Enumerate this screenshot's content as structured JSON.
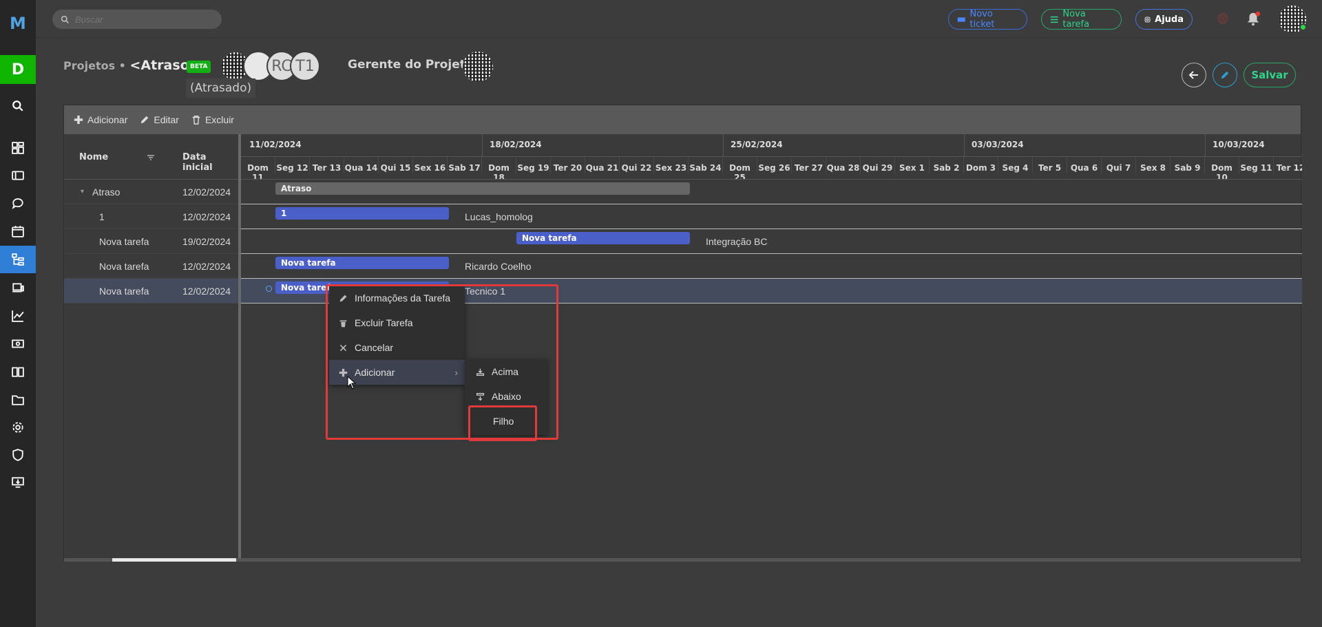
{
  "sidebar": {
    "logo": "M",
    "workspace_initial": "D",
    "items": [
      {
        "name": "search-icon"
      },
      {
        "name": "dashboard-icon"
      },
      {
        "name": "ticket-icon"
      },
      {
        "name": "chat-icon"
      },
      {
        "name": "calendar-icon"
      },
      {
        "name": "projects-icon",
        "active": true
      },
      {
        "name": "devices-icon"
      },
      {
        "name": "chart-icon"
      },
      {
        "name": "money-icon"
      },
      {
        "name": "book-icon"
      },
      {
        "name": "folder-icon"
      },
      {
        "name": "gear-icon"
      },
      {
        "name": "shield-icon"
      },
      {
        "name": "download-icon"
      }
    ],
    "active_color": "#2f7fd6",
    "workspace_color": "#0fb500"
  },
  "topbar": {
    "search_placeholder": "Buscar",
    "new_ticket": "Novo ticket",
    "new_task": "Nova tarefa",
    "help": "Ajuda"
  },
  "header": {
    "section": "Projetos •",
    "project_name": "<Atraso>",
    "beta": "BETA",
    "status": "(Atrasado)",
    "members": [
      "",
      "",
      "RC",
      "T1"
    ],
    "manager_label": "Gerente do Projeto",
    "save": "Salvar"
  },
  "gantt": {
    "toolbar": {
      "add": "Adicionar",
      "edit": "Editar",
      "delete": "Excluir"
    },
    "columns": {
      "name": "Nome",
      "start": "Data inicial"
    },
    "weeks": [
      "11/02/2024",
      "18/02/2024",
      "25/02/2024",
      "03/03/2024",
      "10/03/2024"
    ],
    "days": [
      "Dom 11",
      "Seg 12",
      "Ter 13",
      "Qua 14",
      "Qui 15",
      "Sex 16",
      "Sab 17",
      "Dom 18",
      "Seg 19",
      "Ter 20",
      "Qua 21",
      "Qui 22",
      "Sex 23",
      "Sab 24",
      "Dom 25",
      "Seg 26",
      "Ter 27",
      "Qua 28",
      "Qui 29",
      "Sex 1",
      "Sab 2",
      "Dom 3",
      "Seg 4",
      "Ter 5",
      "Qua 6",
      "Qui 7",
      "Sex 8",
      "Sab 9",
      "Dom 10",
      "Seg 11",
      "Ter 12"
    ],
    "rows": [
      {
        "name": "Atraso",
        "start": "12/02/2024",
        "bar_label": "Atraso",
        "assignee": ""
      },
      {
        "name": "1",
        "start": "12/02/2024",
        "bar_label": "1",
        "assignee": "Lucas_homolog"
      },
      {
        "name": "Nova tarefa",
        "start": "19/02/2024",
        "bar_label": "Nova tarefa",
        "assignee": "Integração BC"
      },
      {
        "name": "Nova tarefa",
        "start": "12/02/2024",
        "bar_label": "Nova tarefa",
        "assignee": "Ricardo Coelho"
      },
      {
        "name": "Nova tarefa",
        "start": "12/02/2024",
        "bar_label": "Nova tarefa",
        "assignee": "Tecnico 1"
      }
    ]
  },
  "context_menu": {
    "info": "Informações da Tarefa",
    "delete": "Excluir Tarefa",
    "cancel": "Cancelar",
    "add": "Adicionar",
    "submenu": {
      "above": "Acima",
      "below": "Abaixo",
      "child": "Filho"
    }
  }
}
